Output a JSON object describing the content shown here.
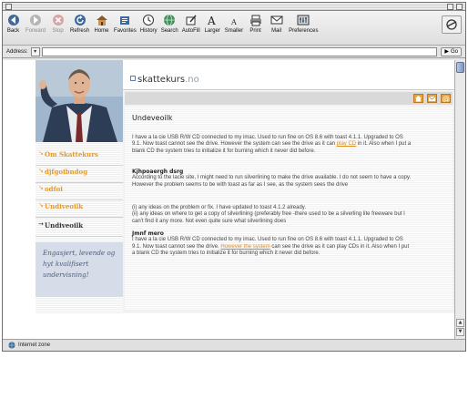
{
  "toolbar": {
    "buttons": [
      {
        "label": "Back",
        "icon": "back-arrow-icon",
        "enabled": true
      },
      {
        "label": "Forward",
        "icon": "forward-arrow-icon",
        "enabled": false
      },
      {
        "label": "Stop",
        "icon": "stop-icon",
        "enabled": false
      },
      {
        "label": "Refresh",
        "icon": "refresh-icon",
        "enabled": true
      },
      {
        "label": "Home",
        "icon": "home-icon",
        "enabled": true
      },
      {
        "label": "Favorites",
        "icon": "favorites-icon",
        "enabled": true
      },
      {
        "label": "History",
        "icon": "history-icon",
        "enabled": true
      },
      {
        "label": "Search",
        "icon": "search-icon",
        "enabled": true
      },
      {
        "label": "AutoFill",
        "icon": "autofill-icon",
        "enabled": true
      },
      {
        "label": "Larger",
        "icon": "larger-text-icon",
        "enabled": true
      },
      {
        "label": "Smaller",
        "icon": "smaller-text-icon",
        "enabled": true
      },
      {
        "label": "Print",
        "icon": "print-icon",
        "enabled": true
      },
      {
        "label": "Mail",
        "icon": "mail-icon",
        "enabled": true
      },
      {
        "label": "Preferences",
        "icon": "preferences-icon",
        "enabled": true
      }
    ]
  },
  "address": {
    "label": "Address:",
    "value": "",
    "go_label": "Go"
  },
  "status": {
    "text": "Internet zone"
  },
  "site": {
    "logo_main": "skattekurs",
    "logo_tld": ".no",
    "accent_color": "#e39a2b",
    "nav": [
      {
        "label": "Om Skattekurs",
        "active": false
      },
      {
        "label": "djfgoibndog",
        "active": false
      },
      {
        "label": "odfoi",
        "active": false
      },
      {
        "label": "Undiveoilk",
        "active": false
      },
      {
        "label": "Undiveoilk",
        "active": true
      }
    ],
    "slogan": "Engasjert, levende og hyt kvalifisert undervisning!",
    "header_icons": [
      "home-icon",
      "mail-icon",
      "at-icon"
    ]
  },
  "article": {
    "title": "Undeveoilk",
    "p1_a": "I have a la cie USB R/W CD connected to my imac. Used to run fine on OS 8.6 with toast 4.1.1. Upgraded to OS 9.1. Now toast cannot see the drive. However the system can see the drive as it can ",
    "p1_link": "play CD",
    "p1_b": " in it. Also when I put a blank CD the system tries to initialize it for burning which it never did before.",
    "h2": "Kjhpoaergh dsrg",
    "p2": "According to the lacie site, I might need to run silverlining to make the drive available. I do not seem to have a copy. However the problem seems to be with toast as far as I see, as the system sees the drive",
    "p3": "(i) any ideas on the problem or fix. I have updated to toast 4.1.2 already.\n(ii) any ideas on where to get a copy of silverlining (preferably free -there used to be a silverling lite freeware but I can't find it any more. Not even quite sure what silverlining does",
    "h3": "Jmnf mero",
    "p4_a": "I have a la cie USB R/W CD connected to my imac. Used to run fine on OS 8.6 with toast 4.1.1. Upgraded to OS 9.1. Now toast cannot see the drive. ",
    "p4_link": "However the system",
    "p4_b": " can see the drive as it can play CDs in it. Also when I put a blank CD the system tries to initialize it for burning which it never did before."
  }
}
